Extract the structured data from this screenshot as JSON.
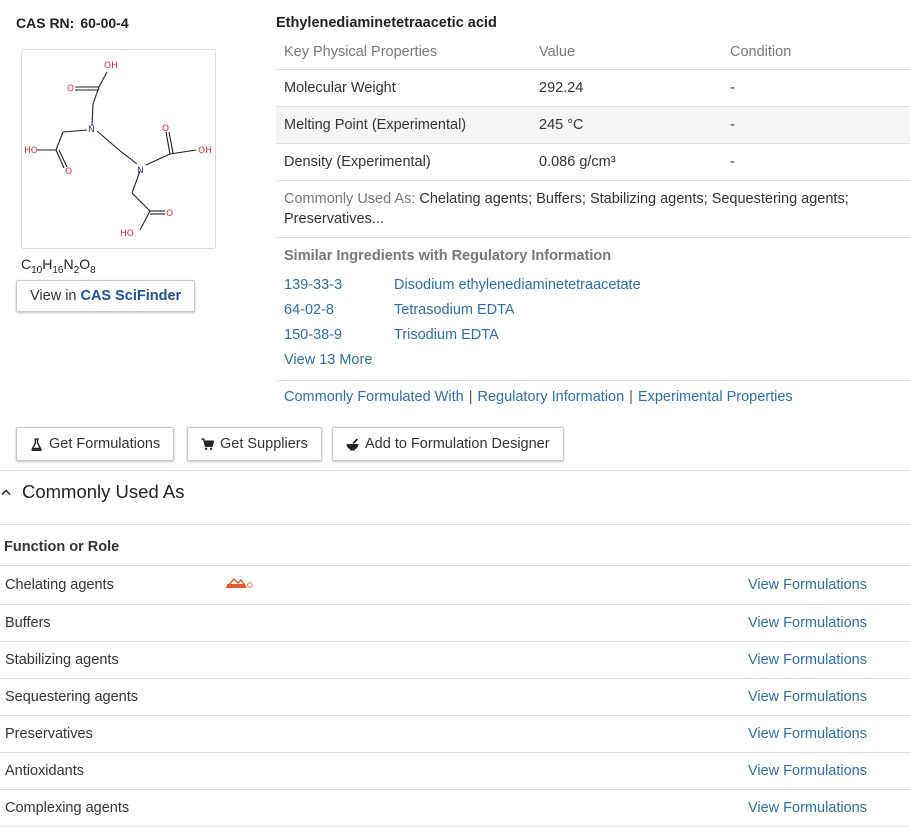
{
  "cas": {
    "label": "CAS RN:",
    "value": "60-00-4"
  },
  "structure": {
    "atoms": [
      "OH",
      "O",
      "N",
      "HO",
      "O",
      "O",
      "OH",
      "N",
      "O",
      "HO"
    ]
  },
  "formula": {
    "parts": [
      {
        "el": "C",
        "n": "10"
      },
      {
        "el": "H",
        "n": "16"
      },
      {
        "el": "N",
        "n": "2"
      },
      {
        "el": "O",
        "n": "8"
      }
    ]
  },
  "scifinder": {
    "prefix": "View in",
    "brand": "CAS SciFinder"
  },
  "ingredient": {
    "title": "Ethylenediaminetetraacetic acid"
  },
  "properties": {
    "headers": [
      "Key Physical Properties",
      "Value",
      "Condition"
    ],
    "rows": [
      {
        "name": "Molecular Weight",
        "value": "292.24",
        "condition": "-"
      },
      {
        "name": "Melting Point (Experimental)",
        "value": "245 °C",
        "condition": "-"
      },
      {
        "name": "Density (Experimental)",
        "value": "0.086 g/cm³",
        "condition": "-"
      }
    ]
  },
  "commonly_used": {
    "label": "Commonly Used As:",
    "text": "Chelating agents; Buffers; Stabilizing agents; Sequestering agents; Preservatives..."
  },
  "similar": {
    "title": "Similar Ingredients with Regulatory Information",
    "items": [
      {
        "cas": "139-33-3",
        "name": "Disodium ethylenediaminetetraacetate"
      },
      {
        "cas": "64-02-8",
        "name": "Tetrasodium EDTA"
      },
      {
        "cas": "150-38-9",
        "name": "Trisodium EDTA"
      }
    ],
    "view_more": "View 13 More"
  },
  "section_links": [
    "Commonly Formulated With",
    "Regulatory Information",
    "Experimental Properties"
  ],
  "link_separator": "|",
  "actions": {
    "formulations": "Get Formulations",
    "suppliers": "Get Suppliers",
    "designer": "Add to Formulation Designer"
  },
  "section": {
    "title": "Commonly Used As"
  },
  "functions": {
    "header": "Function or Role",
    "view_label": "View Formulations",
    "rows": [
      "Chelating agents",
      "Buffers",
      "Stabilizing agents",
      "Sequestering agents",
      "Preservatives",
      "Antioxidants",
      "Complexing agents"
    ]
  },
  "colors": {
    "link": "#2f6fa7",
    "brand": "#1f4f8f",
    "logo": "#e05a2b",
    "atom_o": "#d9302b",
    "atom_n": "#2c3f8f"
  }
}
